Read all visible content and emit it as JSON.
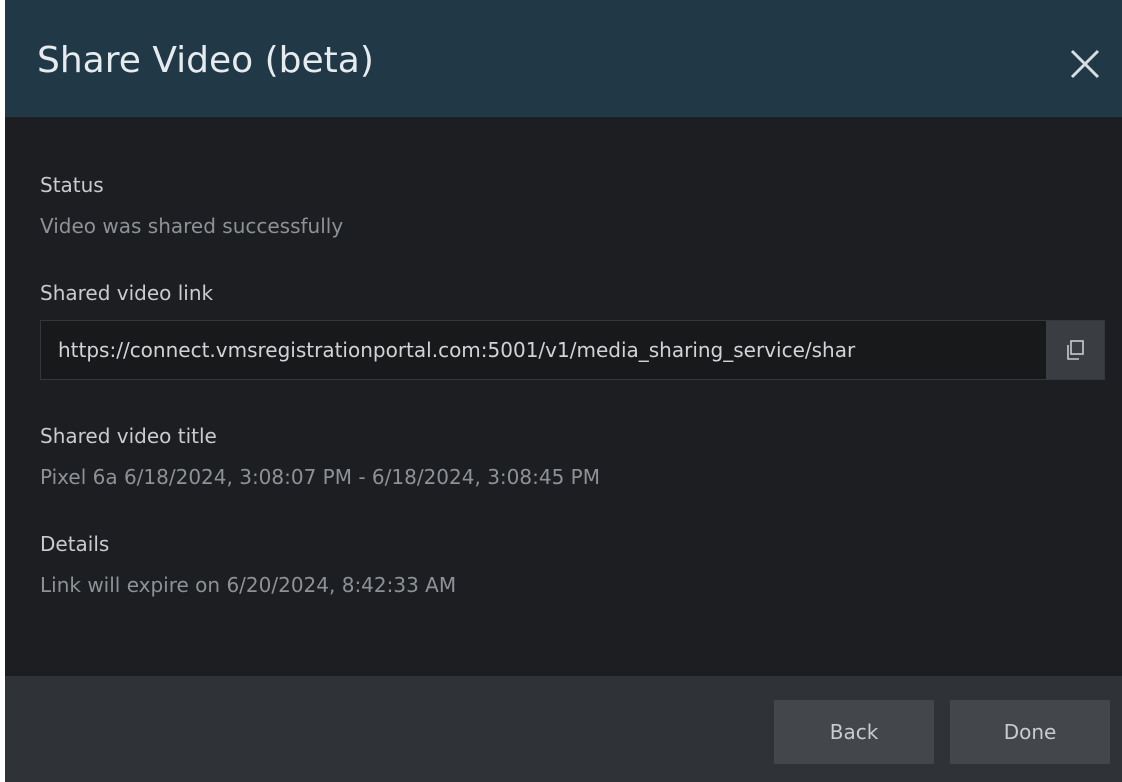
{
  "dialog": {
    "title": "Share Video (beta)",
    "close_icon": "close-icon"
  },
  "status": {
    "label": "Status",
    "value": "Video was shared successfully"
  },
  "link": {
    "label": "Shared video link",
    "value": "https://connect.vmsregistrationportal.com:5001/v1/media_sharing_service/shar",
    "copy_icon": "copy-icon"
  },
  "video_title": {
    "label": "Shared video title",
    "value": "Pixel 6a 6/18/2024, 3:08:07 PM - 6/18/2024, 3:08:45 PM"
  },
  "details": {
    "label": "Details",
    "value": "Link will expire on 6/20/2024, 8:42:33 AM"
  },
  "footer": {
    "back_label": "Back",
    "done_label": "Done"
  },
  "colors": {
    "header_bg": "#213847",
    "body_bg": "#1c1e21",
    "footer_bg": "#2f3236",
    "button_bg": "#43474c"
  }
}
